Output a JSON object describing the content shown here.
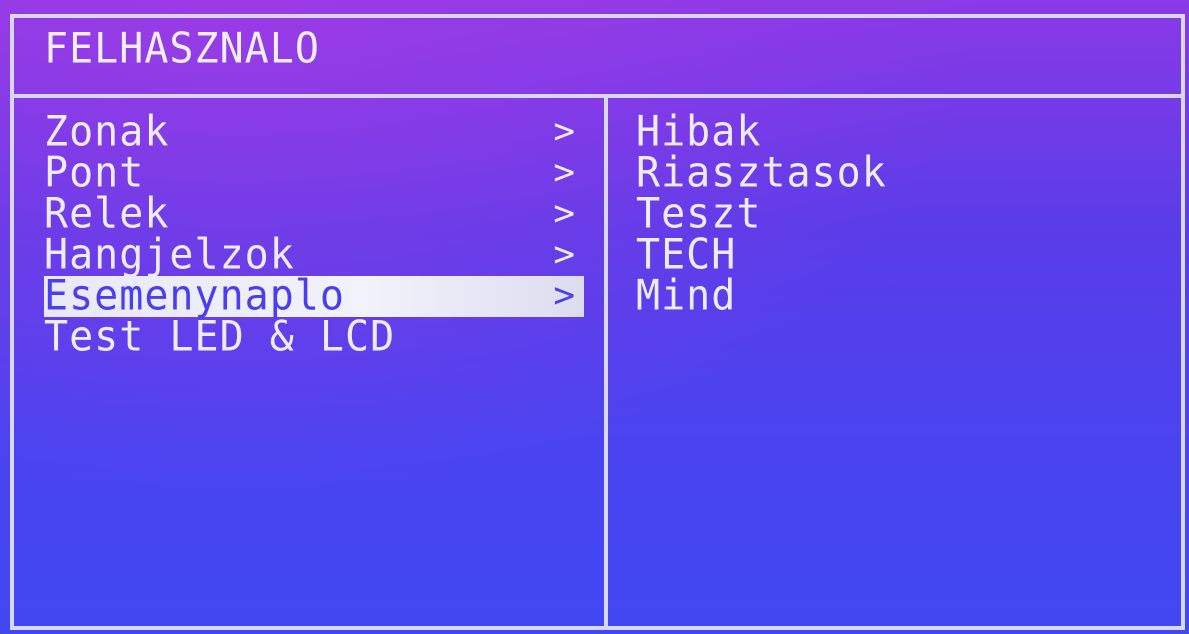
{
  "screen": {
    "title": "FELHASZNALO"
  },
  "left_menu": {
    "items": [
      {
        "label": "Zonak",
        "chevron": ">"
      },
      {
        "label": "Pont",
        "chevron": ">"
      },
      {
        "label": "Relek",
        "chevron": ">"
      },
      {
        "label": "Hangjelzok",
        "chevron": ">"
      },
      {
        "label": "Esemenynaplo",
        "chevron": ">"
      },
      {
        "label": "Test LED & LCD",
        "chevron": ""
      }
    ],
    "selected_index": 4
  },
  "right_menu": {
    "items": [
      {
        "label": "Hibak"
      },
      {
        "label": "Riasztasok"
      },
      {
        "label": "Teszt"
      },
      {
        "label": "TECH"
      },
      {
        "label": "Mind"
      }
    ]
  },
  "colors": {
    "background_top": "#8a3ae6",
    "background_bottom": "#4048f2",
    "foreground": "#ececff",
    "selection_background": "#eeeefa"
  }
}
